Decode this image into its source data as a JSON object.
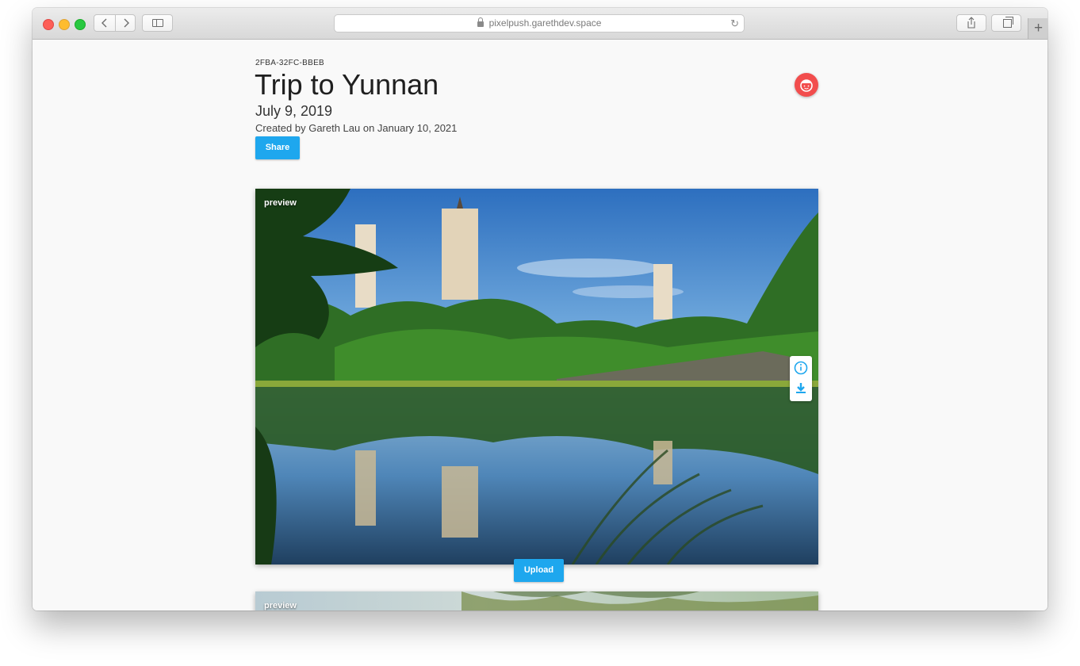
{
  "browser": {
    "url": "pixelpush.garethdev.space",
    "new_tab_label": "+"
  },
  "album": {
    "id": "2FBA-32FC-BBEB",
    "title": "Trip to Yunnan",
    "date": "July 9, 2019",
    "meta": "Created by Gareth Lau on January 10, 2021",
    "share_label": "Share"
  },
  "photos": [
    {
      "label": "preview",
      "actions": [
        "info-icon",
        "download-icon"
      ]
    },
    {
      "label": "preview"
    }
  ],
  "upload_label": "Upload",
  "colors": {
    "accent": "#1ea7ee",
    "avatar": "#f24d4d",
    "page_bg": "#f9f9f9"
  }
}
